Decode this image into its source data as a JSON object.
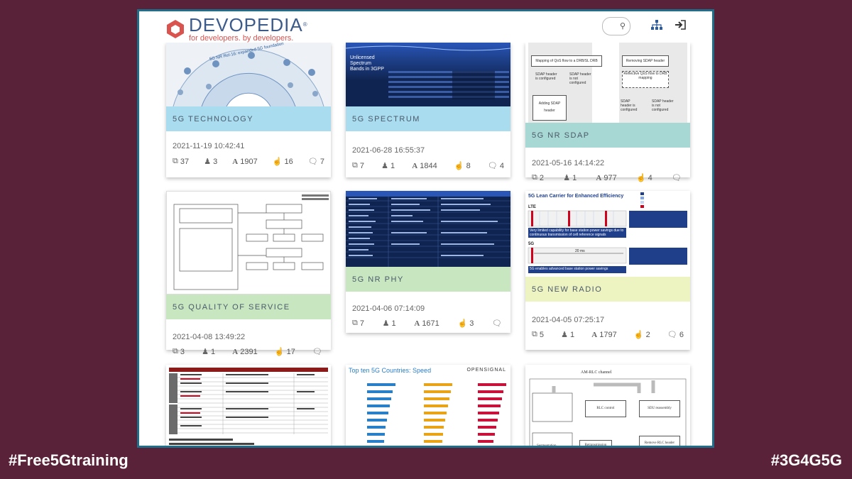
{
  "header": {
    "logo_name": "DEVOPEDIA",
    "logo_reg": "®",
    "logo_tagline": "for developers. by developers."
  },
  "hashtags": {
    "left": "#Free5Gtraining",
    "right": "#3G4G5G"
  },
  "colors": {
    "background": "#5a2238",
    "frame_border": "#1f6f8b",
    "band_blue": "#a9dcef",
    "band_teal": "#a8d8d4",
    "band_green": "#c8e6c0",
    "band_yellow": "#eef3c2"
  },
  "cards": [
    {
      "title": "5G TECHNOLOGY",
      "date": "2021-11-19 10:42:41",
      "versions": "37",
      "authors": "3",
      "words": "1907",
      "likes": "16",
      "comments": "7"
    },
    {
      "title": "5G SPECTRUM",
      "date": "2021-06-28 16:55:37",
      "versions": "7",
      "authors": "1",
      "words": "1844",
      "likes": "8",
      "comments": "4"
    },
    {
      "title": "5G NR SDAP",
      "date": "2021-05-16 14:14:22",
      "versions": "2",
      "authors": "1",
      "words": "977",
      "likes": "4",
      "comments": ""
    },
    {
      "title": "5G QUALITY OF SERVICE",
      "date": "2021-04-08 13:49:22",
      "versions": "3",
      "authors": "1",
      "words": "2391",
      "likes": "17",
      "comments": ""
    },
    {
      "title": "5G NR PHY",
      "date": "2021-04-06 07:14:09",
      "versions": "7",
      "authors": "1",
      "words": "1671",
      "likes": "3",
      "comments": ""
    },
    {
      "title": "5G NEW RADIO",
      "date": "2021-04-05 07:25:17",
      "versions": "5",
      "authors": "1",
      "words": "1797",
      "likes": "2",
      "comments": "6"
    }
  ],
  "thumbs": {
    "tech_title": "5G NR Rel-16: expanded 5G foundation",
    "spectrum_title": "Unlicensed Spectrum Bands in 3GPP",
    "sdap_a": "Mapping of QoS flow to a DRB/SL DRB",
    "sdap_b": "Removing SDAP header",
    "sdap_c": "SDAP header is configured",
    "sdap_d": "SDAP header is not configured",
    "sdap_e": "Adding SDAP header",
    "sdap_f": "Reflective QoS flow to DRB mapping",
    "newradio_title": "5G Lean Carrier for Enhanced Efficiency",
    "newradio_lte": "LTE",
    "newradio_5g": "5G",
    "newradio_20ms": "20 ms",
    "newradio_cap1": "Very limited capability for base station power savings due to continuous transmission of cell reference signals",
    "newradio_cap2": "5G enables advanced base station power savings",
    "countries_title": "Top ten 5G Countries: Speed",
    "countries_brand": "OPENSIGNAL",
    "rlc_title": "AM-RLC channel",
    "rlc_a": "RLC control",
    "rlc_b": "SDU reassembly",
    "rlc_c": "Remove RLC header",
    "rlc_d": "Retransmission",
    "rlc_e": "Segmentation"
  }
}
